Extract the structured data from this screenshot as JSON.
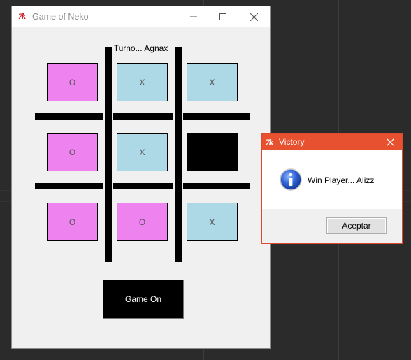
{
  "main_window": {
    "app_icon": "tk-feather-logo",
    "app_icon_text": "7k",
    "title": "Game of Neko",
    "controls": [
      "minimize-icon",
      "maximize-icon",
      "close-icon"
    ]
  },
  "game": {
    "turn_label": "Turno... Agnax",
    "cells": [
      {
        "value": "O",
        "state": "o"
      },
      {
        "value": "X",
        "state": "x"
      },
      {
        "value": "X",
        "state": "x"
      },
      {
        "value": "O",
        "state": "o"
      },
      {
        "value": "X",
        "state": "x"
      },
      {
        "value": "",
        "state": "blank"
      },
      {
        "value": "O",
        "state": "o"
      },
      {
        "value": "O",
        "state": "o"
      },
      {
        "value": "X",
        "state": "x"
      }
    ],
    "button_label": "Game On",
    "colors": {
      "o_cell": "#ee82ee",
      "x_cell": "#add8e6",
      "grid": "#000000"
    }
  },
  "dialog": {
    "app_icon": "tk-feather-logo",
    "app_icon_text": "7k",
    "title": "Victory",
    "icon": "info-icon",
    "message": "Win Player...  Alizz",
    "ok_label": "Aceptar",
    "accent": "#e8512f"
  }
}
